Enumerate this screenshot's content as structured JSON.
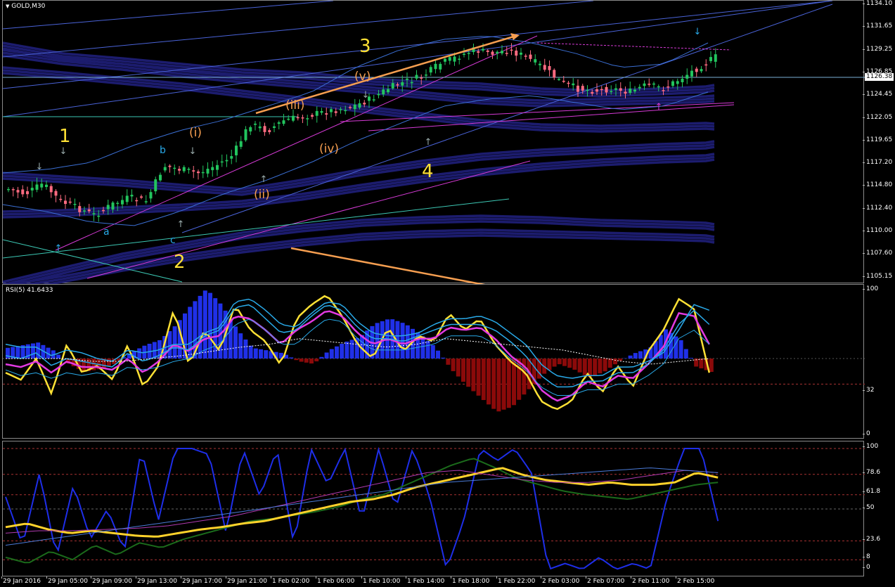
{
  "main": {
    "title": "GOLD,M30",
    "price_ticks": [
      "1134.10",
      "1131.65",
      "1129.25",
      "1126.85",
      "1124.45",
      "1122.05",
      "1119.65",
      "1117.20",
      "1114.80",
      "1112.40",
      "1110.00",
      "1107.60",
      "1105.15"
    ],
    "current_price": "1126.38",
    "waves": {
      "w1": "1",
      "w2": "2",
      "w3": "3",
      "w4": "4",
      "a": "a",
      "b": "b",
      "c": "c",
      "i": "(i)",
      "ii": "(ii)",
      "iii": "(iii)",
      "iv": "(iv)",
      "v": "(v)"
    },
    "colors": {
      "bull": "#22c55e",
      "bear": "#ff6b81",
      "yellow": "#ffe135",
      "orange": "#f59e50",
      "cyan": "#29a9e8"
    }
  },
  "rsi": {
    "title": "RSI(5) 41.6433",
    "ticks": [
      "100",
      "32",
      "0"
    ]
  },
  "stoch": {
    "ticks": [
      "100",
      "78.6",
      "61.8",
      "50",
      "23.6",
      "8",
      "0"
    ]
  },
  "time_axis": [
    "29 Jan 2016",
    "29 Jan 05:00",
    "29 Jan 09:00",
    "29 Jan 13:00",
    "29 Jan 17:00",
    "29 Jan 21:00",
    "1 Feb 02:00",
    "1 Feb 06:00",
    "1 Feb 10:00",
    "1 Feb 14:00",
    "1 Feb 18:00",
    "1 Feb 22:00",
    "2 Feb 03:00",
    "2 Feb 07:00",
    "2 Feb 11:00",
    "2 Feb 15:00"
  ]
}
